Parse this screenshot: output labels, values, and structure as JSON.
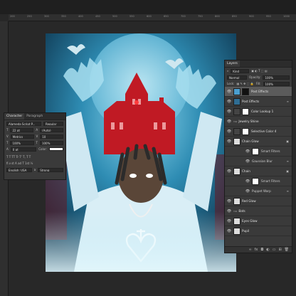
{
  "ruler": {
    "ticks": [
      "200",
      "250",
      "300",
      "350",
      "400",
      "450",
      "500",
      "550",
      "600",
      "650",
      "700",
      "750",
      "800",
      "850",
      "900",
      "950",
      "1000"
    ]
  },
  "character_panel": {
    "tabs": [
      "Character",
      "Paragraph"
    ],
    "font_family": "Alameda Script P...",
    "font_style": "Regular",
    "font_size": "22 pt",
    "leading": "(Auto)",
    "kerning": "Metrics",
    "tracking": "10",
    "vertical_scale": "100%",
    "horizontal_scale": "100%",
    "baseline_shift": "0 pt",
    "color_label": "Color:",
    "language": "English: USA",
    "anti_alias_prefix": "a",
    "anti_alias": "Strong"
  },
  "layers_panel": {
    "title": "Layers",
    "filter": "Kind",
    "blend_mode": "Normal",
    "opacity_label": "Opacity:",
    "opacity": "100%",
    "lock_label": "Lock:",
    "fill_label": "Fill:",
    "fill": "100%",
    "layers": [
      {
        "name": "Post Effects",
        "type": "smart",
        "selected": true
      },
      {
        "name": "Post Effects",
        "type": "group"
      },
      {
        "name": "Color Lookup 1",
        "type": "adjustment"
      },
      {
        "name": "Jewelry Shine",
        "type": "group"
      },
      {
        "name": "Selective Color 4",
        "type": "adjustment"
      },
      {
        "name": "Chain Glow",
        "type": "layer"
      },
      {
        "name": "Smart Filters",
        "type": "sub"
      },
      {
        "name": "Gaussian Blur",
        "type": "sub2"
      },
      {
        "name": "Chain",
        "type": "layer"
      },
      {
        "name": "Smart Filters",
        "type": "sub"
      },
      {
        "name": "Puppet Warp",
        "type": "sub2"
      },
      {
        "name": "Red Glow",
        "type": "layer"
      },
      {
        "name": "Bats",
        "type": "group"
      },
      {
        "name": "Eyes Glow",
        "type": "layer"
      },
      {
        "name": "Pupil",
        "type": "layer"
      }
    ]
  },
  "colors": {
    "accent_red": "#d0232a",
    "glow_blue": "#8fd8ee",
    "bg_dark": "#282828"
  }
}
